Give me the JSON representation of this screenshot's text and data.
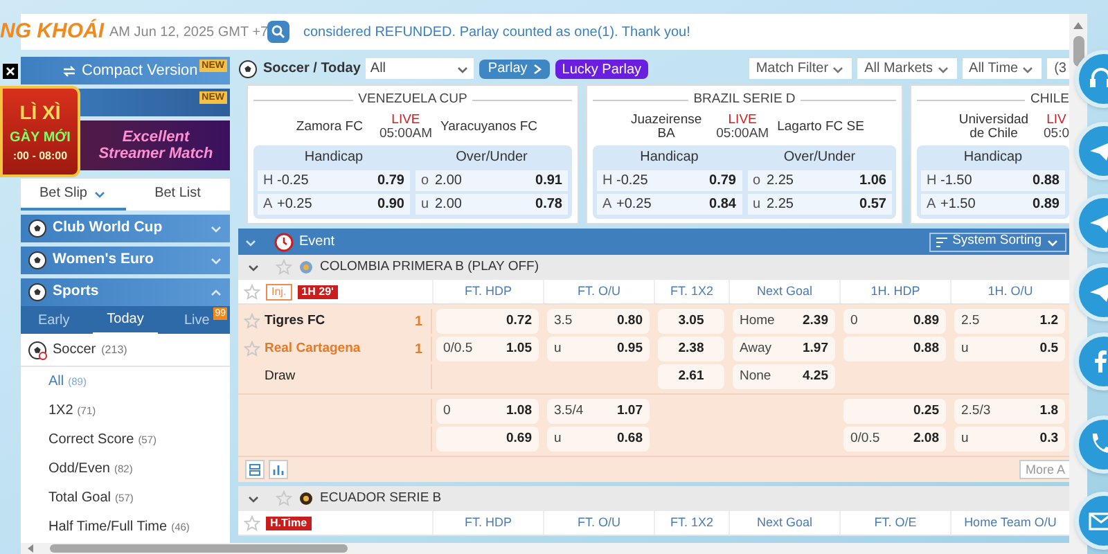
{
  "header": {
    "logo": "NG KHOÁI",
    "datetime": "AM Jun 12, 2025 GMT +7",
    "announcement": "considered REFUNDED. Parlay counted as one(1). Thank you!"
  },
  "promo": {
    "title": "LÌ XÌ",
    "subtitle": "GÀY MỚI",
    "hours": ":00 - 08:00"
  },
  "sidebar": {
    "compact_version": "Compact Version",
    "new_badges": [
      "NEW",
      "NEW"
    ],
    "banner": "Excellent Streamer Match",
    "bet_tabs": [
      {
        "label": "Bet Slip",
        "selected": true
      },
      {
        "label": "Bet List",
        "selected": false
      }
    ],
    "sections": [
      {
        "label": "Club World Cup",
        "expanded": false
      },
      {
        "label": "Women's Euro",
        "expanded": false
      },
      {
        "label": "Sports",
        "expanded": true
      }
    ],
    "period_tabs": [
      {
        "label": "Early",
        "selected": false
      },
      {
        "label": "Today",
        "selected": true
      },
      {
        "label": "Live",
        "selected": false,
        "badge": "99"
      }
    ],
    "sport": {
      "label": "Soccer",
      "count": "(213)"
    },
    "markets": [
      {
        "label": "All",
        "count": "(89)",
        "selected": true
      },
      {
        "label": "1X2",
        "count": "(71)",
        "selected": false
      },
      {
        "label": "Correct Score",
        "count": "(57)",
        "selected": false
      },
      {
        "label": "Odd/Even",
        "count": "(82)",
        "selected": false
      },
      {
        "label": "Total Goal",
        "count": "(57)",
        "selected": false
      },
      {
        "label": "Half Time/Full Time",
        "count": "(46)",
        "selected": false
      }
    ]
  },
  "toolbar": {
    "title": "Soccer / Today",
    "select": "All",
    "parlay": "Parlay",
    "lucky_parlay": "Lucky Parlay",
    "filters": [
      "Match Filter",
      "All Markets",
      "All Time"
    ],
    "cut": "(3"
  },
  "featured": [
    {
      "league": "VENEZUELA CUP",
      "home": "Zamora FC",
      "away": "Yaracuyanos FC",
      "status": "LIVE",
      "time": "05:00AM",
      "markets": [
        {
          "name": "Handicap",
          "rows": [
            {
              "side": "H",
              "line": "-0.25",
              "odds": "0.79"
            },
            {
              "side": "A",
              "line": "+0.25",
              "odds": "0.90"
            }
          ]
        },
        {
          "name": "Over/Under",
          "rows": [
            {
              "side": "o",
              "line": "2.00",
              "odds": "0.91"
            },
            {
              "side": "u",
              "line": "2.00",
              "odds": "0.78"
            }
          ]
        }
      ]
    },
    {
      "league": "BRAZIL SERIE D",
      "home": "Juazeirense BA",
      "away": "Lagarto FC SE",
      "status": "LIVE",
      "time": "05:00AM",
      "markets": [
        {
          "name": "Handicap",
          "rows": [
            {
              "side": "H",
              "line": "-0.25",
              "odds": "0.79"
            },
            {
              "side": "A",
              "line": "+0.25",
              "odds": "0.84"
            }
          ]
        },
        {
          "name": "Over/Under",
          "rows": [
            {
              "side": "o",
              "line": "2.25",
              "odds": "1.06"
            },
            {
              "side": "u",
              "line": "2.25",
              "odds": "0.57"
            }
          ]
        }
      ]
    },
    {
      "league": "CHILE",
      "home": "Universidad de Chile",
      "status": "LIV",
      "time": "05:0",
      "markets": [
        {
          "name": "Handicap",
          "rows": [
            {
              "side": "H",
              "line": "-1.50",
              "odds": "0.88"
            },
            {
              "side": "A",
              "line": "+1.50",
              "odds": "0.89"
            }
          ]
        }
      ]
    }
  ],
  "events": {
    "label": "Event",
    "sorting": "System Sorting"
  },
  "leagues": [
    {
      "name": "COLOMBIA PRIMERA B (PLAY OFF)",
      "expanded": true,
      "badges": [
        {
          "kind": "injury",
          "text": "Inj."
        },
        {
          "kind": "live",
          "text": "1H 29'"
        }
      ],
      "columns": [
        "FT. HDP",
        "FT. O/U",
        "FT. 1X2",
        "Next Goal",
        "1H. HDP",
        "1H. O/U"
      ],
      "teams": [
        {
          "name": "Tigres FC",
          "score": "1",
          "favorite": false
        },
        {
          "name": "Real Cartagena",
          "score": "1",
          "favorite": true
        },
        {
          "name": "Draw"
        }
      ],
      "groups": [
        [
          {
            "ft_hdp": {
              "odds": "0.72"
            },
            "ft_ou": {
              "line": "3.5",
              "odds": "0.80"
            },
            "ft_1x2": {
              "odds": "3.05"
            },
            "next_goal": {
              "line": "Home",
              "odds": "2.39"
            },
            "h1_hdp": {
              "line": "0",
              "odds": "0.89"
            },
            "h1_ou": {
              "line": "2.5",
              "odds": "1.2"
            }
          },
          {
            "ft_hdp": {
              "line": "0/0.5",
              "odds": "1.05"
            },
            "ft_ou": {
              "line": "u",
              "odds": "0.95"
            },
            "ft_1x2": {
              "odds": "2.38"
            },
            "next_goal": {
              "line": "Away",
              "odds": "1.97"
            },
            "h1_hdp": {
              "odds": "0.88"
            },
            "h1_ou": {
              "line": "u",
              "odds": "0.5"
            }
          },
          {
            "ft_1x2": {
              "odds": "2.61"
            },
            "next_goal": {
              "line": "None",
              "odds": "4.25"
            }
          }
        ],
        [
          {
            "ft_hdp": {
              "line": "0",
              "odds": "1.08"
            },
            "ft_ou": {
              "line": "3.5/4",
              "odds": "1.07"
            },
            "h1_hdp": {
              "odds": "0.25"
            },
            "h1_ou": {
              "line": "2.5/3",
              "odds": "1.8"
            }
          },
          {
            "ft_hdp": {
              "odds": "0.69"
            },
            "ft_ou": {
              "line": "u",
              "odds": "0.68"
            },
            "h1_hdp": {
              "line": "0/0.5",
              "odds": "2.08"
            },
            "h1_ou": {
              "line": "u",
              "odds": "0.3"
            }
          }
        ]
      ],
      "more": "More A"
    },
    {
      "name": "ECUADOR SERIE B",
      "expanded": true,
      "badges": [
        {
          "kind": "live",
          "text": "H.Time"
        }
      ],
      "columns": [
        "FT. HDP",
        "FT. O/U",
        "FT. 1X2",
        "Next Goal",
        "FT. O/E",
        "Home Team O/U"
      ]
    }
  ]
}
